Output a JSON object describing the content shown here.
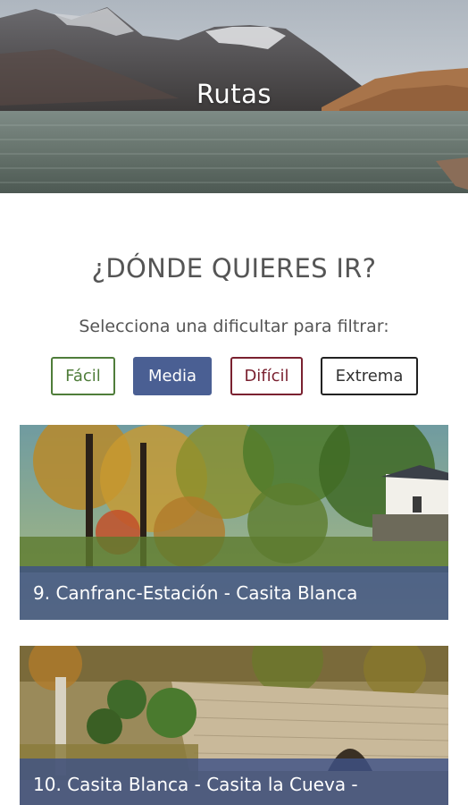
{
  "header": {
    "title": "Rutas"
  },
  "main": {
    "heading": "¿DÓNDE QUIERES IR?",
    "filter_label": "Selecciona una dificultar para filtrar:",
    "filters": [
      {
        "label": "Fácil",
        "color": "#4f7d3a",
        "selected": false
      },
      {
        "label": "Media",
        "color": "#4a5f93",
        "selected": true
      },
      {
        "label": "Difícil",
        "color": "#7a2130",
        "selected": false
      },
      {
        "label": "Extrema",
        "color": "#222222",
        "selected": false
      }
    ],
    "routes": [
      {
        "title": "9. Canfranc-Estación - Casita Blanca"
      },
      {
        "title": "10. Casita Blanca - Casita la Cueva -"
      }
    ]
  },
  "colors": {
    "caption_overlay": "#3e5286",
    "text": "#555555"
  }
}
